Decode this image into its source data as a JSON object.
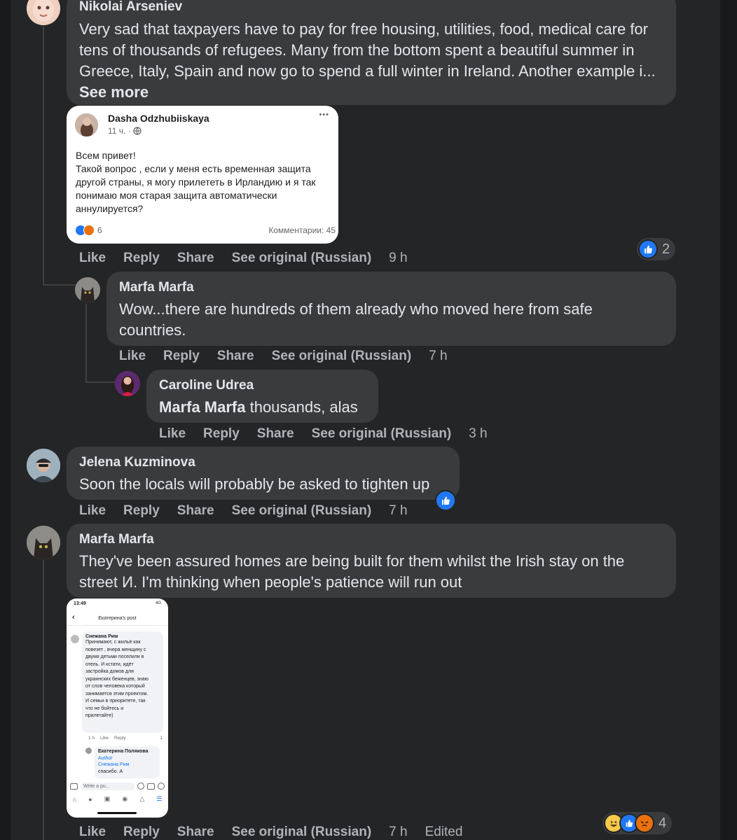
{
  "comments": [
    {
      "author": "Nikolai Arseniev",
      "text": "Very sad that taxpayers have to pay for free housing, utilities, food, medical care for tens of thousands of refugees. Many from the bottom spent a beautiful summer in Greece, Italy, Spain and now go to spend a full winter in Ireland. Another example i...",
      "see_more": "See more",
      "actions": {
        "like": "Like",
        "reply": "Reply",
        "share": "Share",
        "translate": "See original (Russian)",
        "time": "9 h"
      },
      "reaction_count": "2",
      "attachment": {
        "author": "Dasha Odzhubiiskaya",
        "time": "11 ч. ·",
        "more": "•••",
        "text_line1": "Всем привет!",
        "text_line2": "Такой вопрос , если у меня есть временная защита другой страны, я могу прилететь в Ирландию и я так понимаю моя старая защита автоматически аннулируется?",
        "reactions": "6",
        "comments": "Комментарии: 45"
      }
    },
    {
      "author": "Marfa Marfa",
      "text": "Wow...there are hundreds of them already who moved here from safe countries.",
      "actions": {
        "like": "Like",
        "reply": "Reply",
        "share": "Share",
        "translate": "See original (Russian)",
        "time": "7 h"
      }
    },
    {
      "author": "Caroline Udrea",
      "mention": "Marfa Marfa",
      "text": " thousands, alas",
      "actions": {
        "like": "Like",
        "reply": "Reply",
        "share": "Share",
        "translate": "See original (Russian)",
        "time": "3 h"
      }
    },
    {
      "author": "Jelena Kuzminova",
      "text": "Soon the locals will probably be asked to tighten up",
      "actions": {
        "like": "Like",
        "reply": "Reply",
        "share": "Share",
        "translate": "See original (Russian)",
        "time": "7 h"
      }
    },
    {
      "author": "Marfa Marfa",
      "text": "They've been assured homes are being built for them whilst the Irish stay on the street И. I'm thinking when people's patience will run out",
      "actions": {
        "like": "Like",
        "reply": "Reply",
        "share": "Share",
        "translate": "See original (Russian)",
        "time": "7 h",
        "edited": "Edited"
      },
      "reaction_count": "4",
      "attachment": {
        "status_time": "13:49",
        "status_right": "4G",
        "header": "Екатерина's post",
        "c1_author": "Снежана Рим",
        "c1_text": "Принимают, с жильё как повезет , вчера женщину с двумя детьми поселили в отель. И кстати, идёт застройка домов для украинских беженцев, знаю от слов человека который занимается этим проектом. И семьи в приоритете, так что не бойтесь и прилетайте)",
        "c1_time": "1 h",
        "c1_like": "Like",
        "c1_reply": "Reply",
        "c1_count": "1",
        "c2_author": "Екатерина Полякова",
        "c2_badge": "Author",
        "c2_mention": "Снежана Рим",
        "c2_text": "спасибо. А",
        "write_placeholder": "Write a pu..."
      }
    }
  ],
  "colors": {
    "background": "#18191a",
    "panel": "#242526",
    "bubble": "#3a3b3c",
    "text": "#e4e6eb",
    "secondary": "#b0b3b8",
    "like_blue": "#2078f4"
  }
}
